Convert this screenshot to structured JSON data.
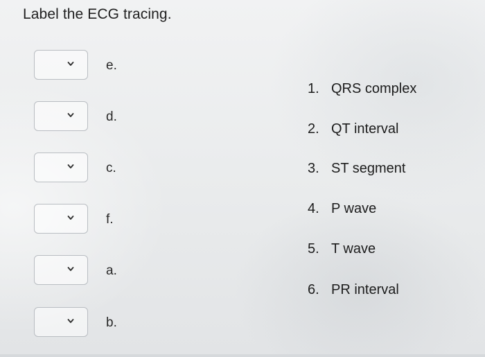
{
  "question": {
    "title": "Label the ECG tracing."
  },
  "dropdown_rows": [
    {
      "letter": "e.",
      "selected": ""
    },
    {
      "letter": "d.",
      "selected": ""
    },
    {
      "letter": "c.",
      "selected": ""
    },
    {
      "letter": "f.",
      "selected": ""
    },
    {
      "letter": "a.",
      "selected": ""
    },
    {
      "letter": "b.",
      "selected": ""
    }
  ],
  "options": [
    {
      "number": "1.",
      "label": "QRS complex"
    },
    {
      "number": "2.",
      "label": "QT interval"
    },
    {
      "number": "3.",
      "label": "ST segment"
    },
    {
      "number": "4.",
      "label": "P wave"
    },
    {
      "number": "5.",
      "label": "T wave"
    },
    {
      "number": "6.",
      "label": "PR interval"
    }
  ],
  "icons": {
    "dropdown_arrow": "chevron-down-icon"
  }
}
